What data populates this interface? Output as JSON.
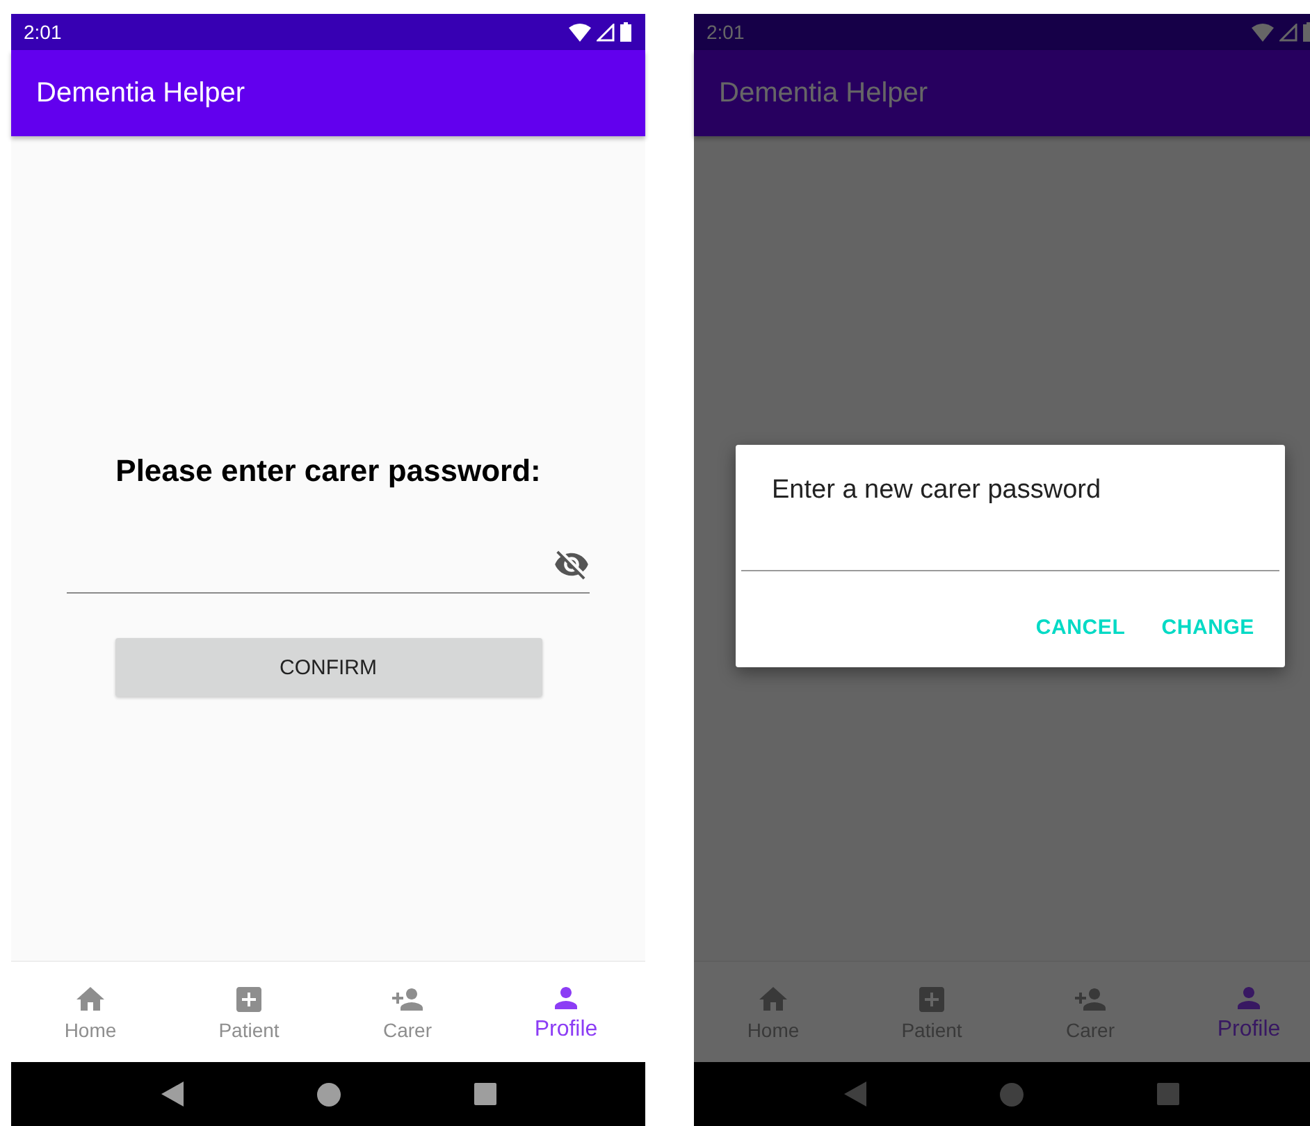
{
  "screens": [
    {
      "dimmed": false,
      "status_bar": {
        "time": "2:01"
      },
      "app_bar": {
        "title": "Dementia Helper"
      },
      "content": {
        "kind": "password_form",
        "prompt": "Please enter carer password:",
        "button": "CONFIRM"
      },
      "bottom_nav": [
        {
          "kind": "home",
          "label": "Home",
          "selected": false
        },
        {
          "kind": "add",
          "label": "Patient",
          "selected": false
        },
        {
          "kind": "person_add",
          "label": "Carer",
          "selected": false
        },
        {
          "kind": "person",
          "label": "Profile",
          "selected": true
        }
      ]
    },
    {
      "dimmed": true,
      "status_bar": {
        "time": "2:01"
      },
      "app_bar": {
        "title": "Dementia Helper"
      },
      "content": {
        "kind": "dialog",
        "title": "Enter a new carer password",
        "buttons": [
          "CANCEL",
          "CHANGE"
        ]
      },
      "bottom_nav": [
        {
          "kind": "home",
          "label": "Home",
          "selected": false
        },
        {
          "kind": "add",
          "label": "Patient",
          "selected": false
        },
        {
          "kind": "person_add",
          "label": "Carer",
          "selected": false
        },
        {
          "kind": "person",
          "label": "Profile",
          "selected": true
        }
      ]
    }
  ]
}
